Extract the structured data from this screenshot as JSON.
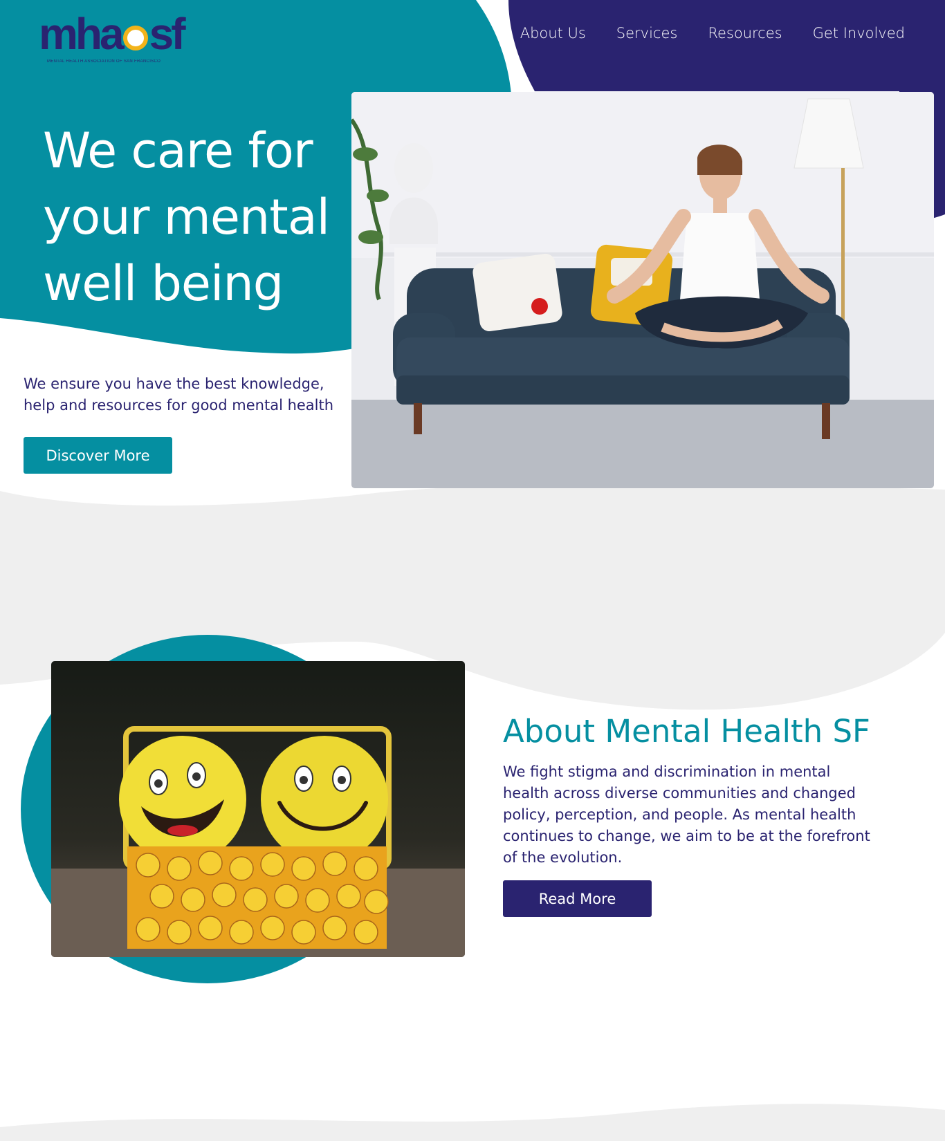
{
  "logo": {
    "wordmark_left": "mha",
    "wordmark_right": "sf",
    "tagline": "MENTAL HEALTH ASSOCIATION OF SAN FRANCISCO"
  },
  "nav": {
    "items": [
      {
        "label": "About Us"
      },
      {
        "label": "Services"
      },
      {
        "label": "Resources"
      },
      {
        "label": "Get Involved"
      }
    ]
  },
  "hero": {
    "title": "We care for your mental well being",
    "description": "We ensure you have the best knowledge, help and resources for good mental health",
    "button_label": "Discover More",
    "image": "photo of woman meditating cross-legged on a navy sofa"
  },
  "about": {
    "title": "About Mental Health SF",
    "text": "We fight stigma and discrimination in mental health across diverse communities and changed policy, perception, and people. As mental health continues to change, we aim to be at the forefront of the evolution.",
    "button_label": "Read More",
    "image": "photo of two yellow smiley plush toys in an emoji tin box"
  },
  "colors": {
    "teal": "#058fa1",
    "navy": "#2a2370",
    "light_gray": "#efefef",
    "white": "#ffffff"
  }
}
